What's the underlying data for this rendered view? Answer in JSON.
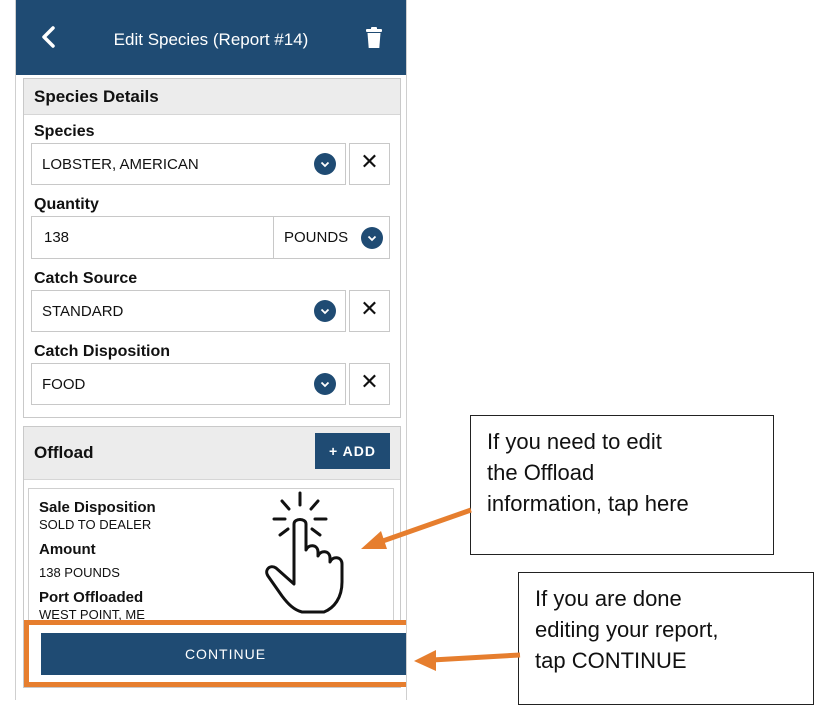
{
  "header": {
    "title": "Edit Species (Report #14)",
    "back_icon": "chevron-left-icon",
    "delete_icon": "trash-icon",
    "color": "#1f4b73"
  },
  "species_details": {
    "section_title": "Species Details",
    "species": {
      "label": "Species",
      "value": "LOBSTER, AMERICAN",
      "clear": "✕"
    },
    "quantity": {
      "label": "Quantity",
      "value": "138",
      "unit": "POUNDS"
    },
    "catch_source": {
      "label": "Catch Source",
      "value": "STANDARD",
      "clear": "✕"
    },
    "catch_disposition": {
      "label": "Catch Disposition",
      "value": "FOOD",
      "clear": "✕"
    }
  },
  "offload": {
    "section_title": "Offload",
    "add_button": "+ ADD",
    "entry": {
      "sale_disposition_label": "Sale Disposition",
      "sale_disposition_value": "SOLD TO DEALER",
      "amount_label": "Amount",
      "amount_value": "138 POUNDS",
      "port_label": "Port Offloaded",
      "port_value": "WEST POINT, ME"
    }
  },
  "continue_button": "CONTINUE",
  "callouts": {
    "offload": [
      "If you need to edit",
      "the Offload",
      "information, tap here"
    ],
    "continue": [
      "If you are done",
      "editing your report,",
      "tap CONTINUE"
    ]
  },
  "colors": {
    "primary": "#1f4b73",
    "highlight": "#e67e2e"
  }
}
